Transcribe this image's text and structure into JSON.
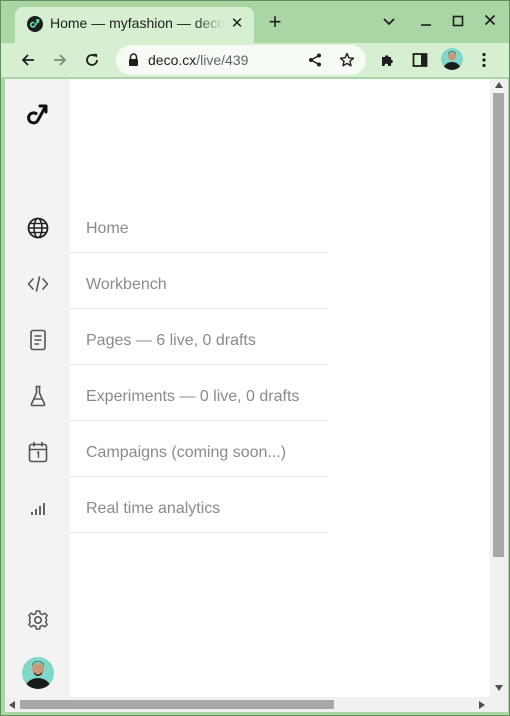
{
  "browser": {
    "tab": {
      "title": "Home — myfashion — deco.cx",
      "favicon": "deco-logo-icon",
      "close_glyph": "✕"
    },
    "new_tab_glyph": "+",
    "window_controls": {
      "tab_search": "chevron-down-icon",
      "minimize": "minimize-icon",
      "maximize": "maximize-icon",
      "close": "close-icon"
    },
    "toolbar": {
      "back": "back-arrow-icon",
      "forward": "forward-arrow-icon",
      "reload": "reload-icon",
      "url_host": "deco.cx",
      "url_path": "/live/439",
      "share": "share-icon",
      "bookmark": "star-icon",
      "extensions": "puzzle-icon",
      "side_panel": "side-panel-icon",
      "profile": "avatar",
      "menu": "kebab-menu-icon"
    },
    "colors": {
      "frame": "#a9d6a4",
      "tab_active": "#d6efd1",
      "omnibox": "#f6fbf4"
    }
  },
  "app": {
    "logo": "deco-logo-icon",
    "nav": [
      {
        "icon": "globe-icon",
        "label": "Home"
      },
      {
        "icon": "code-icon",
        "label": "Workbench"
      },
      {
        "icon": "document-icon",
        "label": "Pages — 6 live, 0 drafts"
      },
      {
        "icon": "flask-icon",
        "label": "Experiments — 0 live, 0 drafts"
      },
      {
        "icon": "calendar-icon",
        "label": "Campaigns (coming soon...)"
      },
      {
        "icon": "bar-chart-icon",
        "label": "Real time analytics"
      }
    ],
    "settings_icon": "gear-icon",
    "user_avatar": "avatar",
    "colors": {
      "sidebar": "#f3f3f3",
      "label": "#8a8a8a",
      "divider": "#e4e4e4"
    }
  }
}
